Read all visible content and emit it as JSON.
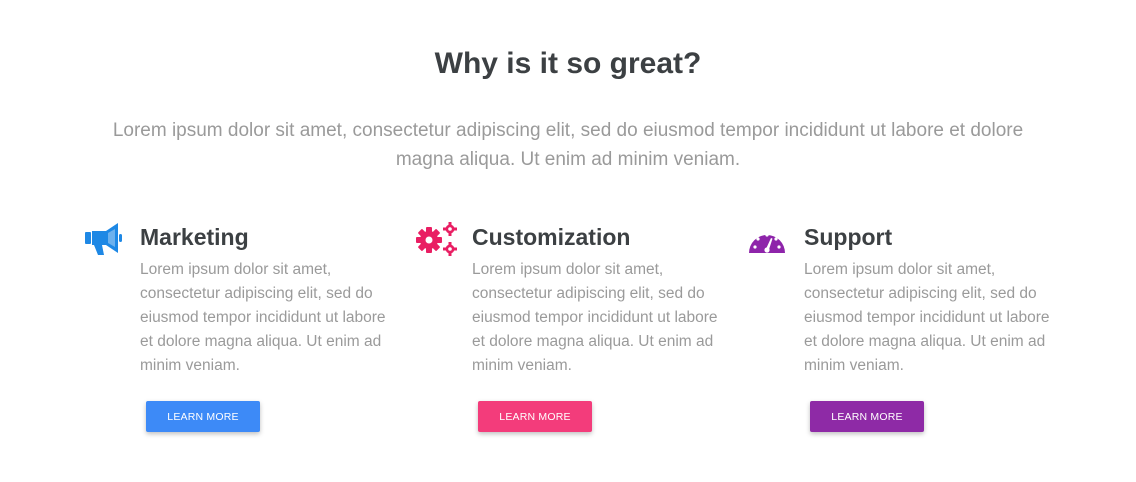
{
  "section": {
    "title": "Why is it so great?",
    "lead": "Lorem ipsum dolor sit amet, consectetur adipiscing elit, sed do eiusmod tempor incididunt ut labore et dolore magna aliqua. Ut enim ad minim veniam."
  },
  "features": [
    {
      "icon": "megaphone-icon",
      "icon_color": "#1e88e5",
      "title": "Marketing",
      "text": "Lorem ipsum dolor sit amet, consectetur adipiscing elit, sed do eiusmod tempor incididunt ut labore et dolore magna aliqua. Ut enim ad minim veniam.",
      "button_label": "LEARN MORE",
      "button_color": "#3d8af7"
    },
    {
      "icon": "gears-icon",
      "icon_color": "#e91e63",
      "title": "Customization",
      "text": "Lorem ipsum dolor sit amet, consectetur adipiscing elit, sed do eiusmod tempor incididunt ut labore et dolore magna aliqua. Ut enim ad minim veniam.",
      "button_label": "LEARN MORE",
      "button_color": "#f33c7b"
    },
    {
      "icon": "speedometer-icon",
      "icon_color": "#8e24aa",
      "title": "Support",
      "text": "Lorem ipsum dolor sit amet, consectetur adipiscing elit, sed do eiusmod tempor incididunt ut labore et dolore magna aliqua. Ut enim ad minim veniam.",
      "button_label": "LEARN MORE",
      "button_color": "#8e2aa6"
    }
  ]
}
